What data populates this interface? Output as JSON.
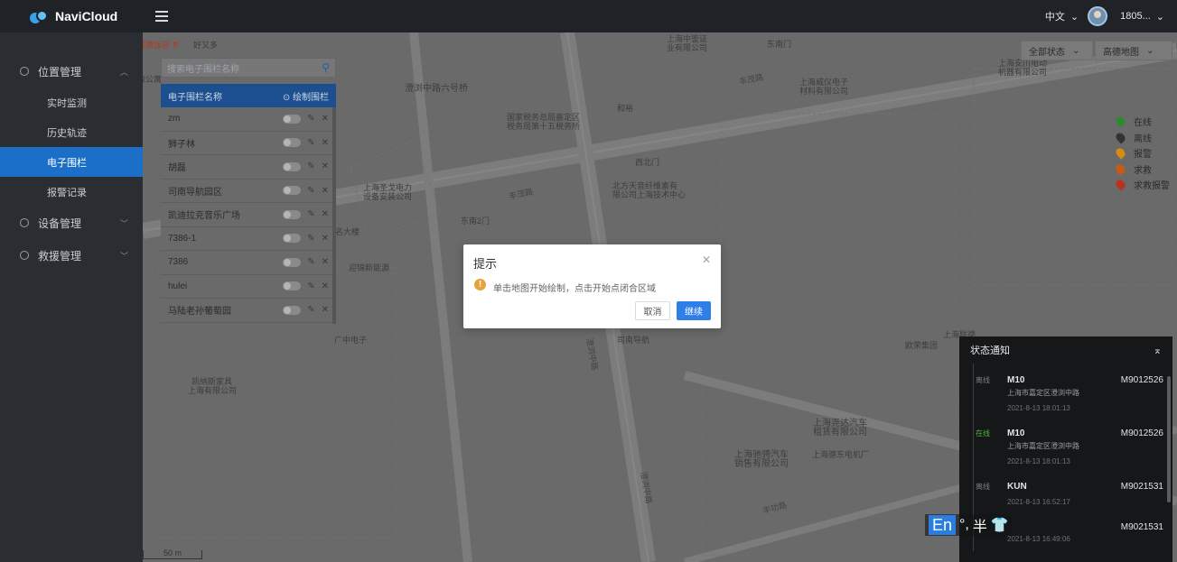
{
  "brand": {
    "name": "NaviCloud"
  },
  "topbar": {
    "language": "中文",
    "user": "1805..."
  },
  "sidebar": {
    "groups": [
      {
        "label": "位置管理",
        "items": [
          "实时监测",
          "历史轨迹",
          "电子围栏",
          "报警记录"
        ],
        "active": "电子围栏"
      },
      {
        "label": "设备管理"
      },
      {
        "label": "救援管理"
      }
    ]
  },
  "fence": {
    "search_placeholder": "搜索电子围栏名称",
    "header_name": "电子围栏名称",
    "header_draw": "⊙ 绘制围栏",
    "rows": [
      "zm",
      "狮子林",
      "胡磊",
      "司南导航园区",
      "凯迪拉克音乐广场",
      "7386-1",
      "7386",
      "hulei",
      "马陆老孙葡萄园"
    ]
  },
  "filters": {
    "status": "全部状态",
    "map": "高德地图"
  },
  "legend": {
    "items": [
      {
        "label": "在线",
        "color": "#2e8a2e"
      },
      {
        "label": "离线",
        "color": "#333333"
      },
      {
        "label": "报警",
        "color": "#d98a12"
      },
      {
        "label": "求救",
        "color": "#c95a12"
      },
      {
        "label": "求救报警",
        "color": "#b8331a"
      }
    ]
  },
  "status_panel": {
    "title": "状态通知",
    "items": [
      {
        "state": "离线",
        "name": "M10",
        "code": "M9012526",
        "address": "上海市嘉定区澄浏中路",
        "time": "2021-8-13 18:01:13"
      },
      {
        "state": "在线",
        "name": "M10",
        "code": "M9012526",
        "address": "上海市嘉定区澄浏中路",
        "time": "2021-8-13 18:01:13"
      },
      {
        "state": "离线",
        "name": "KUN",
        "code": "M9021531",
        "address": "",
        "time": "2021-8-13 16:52:17"
      },
      {
        "state": "",
        "name": "",
        "code": "M9021531",
        "address": "",
        "time": "2021-8-13 16:49:06"
      }
    ]
  },
  "dialog": {
    "title": "提示",
    "message": "单击地图开始绘制，点击开始点闭合区域",
    "cancel": "取消",
    "confirm": "继续"
  },
  "map": {
    "scale": "50 m",
    "labels": {
      "l1": "好又多",
      "l2": "澄浏中路六号桥",
      "l3": "国家税务总局嘉定区",
      "l3b": "税务局第十五税务所",
      "l4": "和裕",
      "l5": "西北门",
      "l6": "北方天音纤维素有",
      "l6b": "限公司上海技术中心",
      "l7": "上海圣戈电力",
      "l7b": "设备安装公司",
      "l8": "东南2门",
      "l9": "丰茂路",
      "l10": "上海威仪电子",
      "l10b": "材料有限公司",
      "l11": "东南门",
      "l12": "上海安川电动",
      "l12b": "机器有限公司",
      "l13": "广中电子",
      "l14": "司南导航",
      "l15": "凯纳斯家具",
      "l15b": "上海有限公司",
      "l16": "上海尧达汽车",
      "l16b": "租赁有限公司",
      "l17": "上海驰骋汽车",
      "l17b": "销售有限公司",
      "l18": "上海德东电机厂",
      "l19": "丰功路",
      "l20": "澄浏中路",
      "l21": "上海中鉴证",
      "l21b": "业有限公司",
      "l22": "欧荣集团",
      "l23": "上海联德",
      "l24": "迎锦新能源",
      "l25": "名大楼"
    },
    "ime": {
      "mode": "En",
      "punct": "°,",
      "width": "半"
    }
  }
}
